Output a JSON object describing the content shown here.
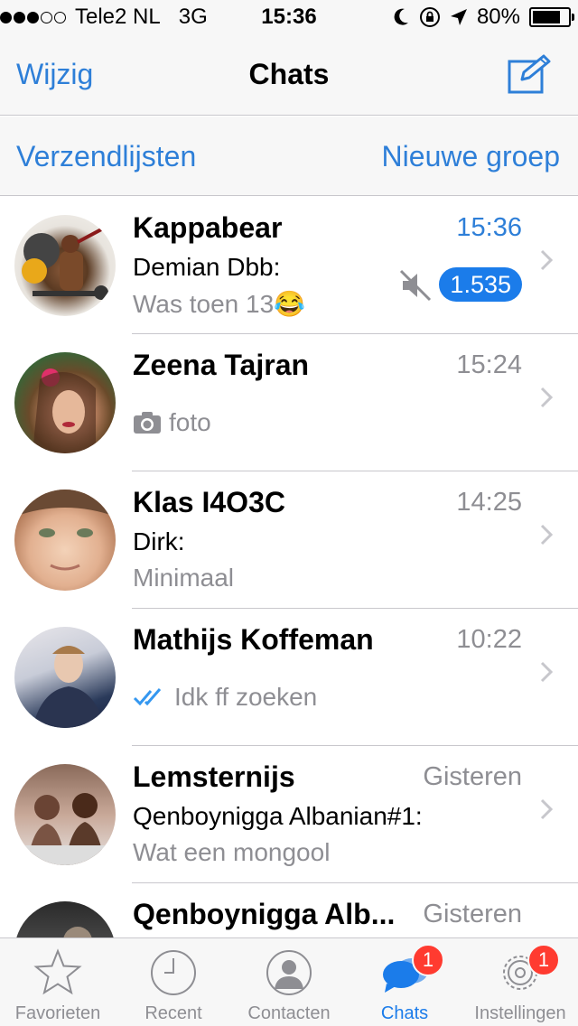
{
  "status_bar": {
    "carrier": "Tele2 NL",
    "network": "3G",
    "time": "15:36",
    "battery": "80%",
    "battery_level": 0.8
  },
  "nav": {
    "edit_label": "Wijzig",
    "title": "Chats",
    "compose_icon": "compose-icon"
  },
  "subbar": {
    "broadcast_label": "Verzendlijsten",
    "new_group_label": "Nieuwe groep"
  },
  "chats": [
    {
      "name": "Kappabear",
      "time": "15:36",
      "sender": "Demian Dbb:",
      "message": "Was toen 13😂",
      "unread": "1.535",
      "muted": true
    },
    {
      "name": "Zeena Tajran",
      "time": "15:24",
      "sender": "",
      "message": "foto",
      "icon": "camera-icon"
    },
    {
      "name": "Klas I4O3C",
      "time": "14:25",
      "sender": "Dirk:",
      "message": "Minimaal"
    },
    {
      "name": "Mathijs Koffeman",
      "time": "10:22",
      "sender": "",
      "message": "Idk ff zoeken",
      "icon": "double-check-icon"
    },
    {
      "name": "Lemsternijs",
      "time": "Gisteren",
      "sender": "Qenboynigga Albanian#1:",
      "message": "Wat een mongool"
    },
    {
      "name": "Qenboynigga Alb...",
      "time": "Gisteren",
      "sender": "",
      "message": ""
    }
  ],
  "tabs": [
    {
      "label": "Favorieten",
      "icon": "star-icon"
    },
    {
      "label": "Recent",
      "icon": "clock-icon"
    },
    {
      "label": "Contacten",
      "icon": "contact-icon"
    },
    {
      "label": "Chats",
      "icon": "chats-icon",
      "badge": "1",
      "active": true
    },
    {
      "label": "Instellingen",
      "icon": "gear-icon",
      "badge": "1"
    }
  ],
  "colors": {
    "accent": "#2e7fd8",
    "badge_blue": "#1b7cea",
    "badge_red": "#ff3b30"
  }
}
